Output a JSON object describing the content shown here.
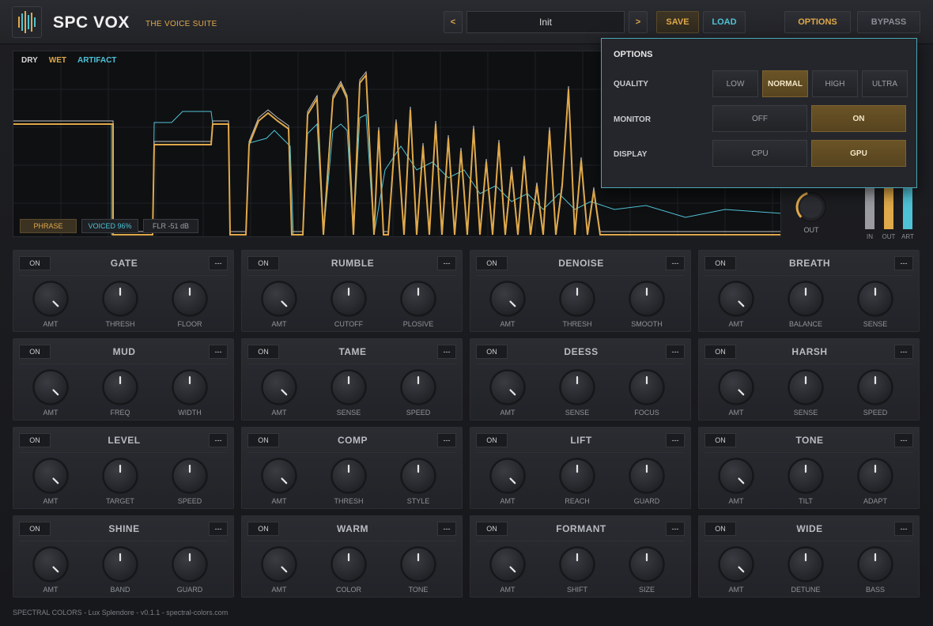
{
  "header": {
    "brand": "SPC VOX",
    "tagline": "THE VOICE SUITE",
    "prev_label": "<",
    "next_label": ">",
    "preset": "Init",
    "save_label": "SAVE",
    "load_label": "LOAD",
    "options_label": "OPTIONS",
    "bypass_label": "BYPASS"
  },
  "scope": {
    "legend": {
      "dry": "DRY",
      "wet": "WET",
      "artifact": "ARTIFACT"
    },
    "chips": {
      "phrase": "PHRASE",
      "voiced": "VOICED 96%",
      "floor": "FLR -51 dB"
    },
    "out_label": "OUT",
    "meters": {
      "in": "IN",
      "out": "OUT",
      "art": "ART"
    }
  },
  "options": {
    "title": "OPTIONS",
    "quality_label": "QUALITY",
    "quality": [
      "LOW",
      "NORMAL",
      "HIGH",
      "ULTRA"
    ],
    "quality_selected": "NORMAL",
    "monitor_label": "MONITOR",
    "monitor": [
      "OFF",
      "ON"
    ],
    "monitor_selected": "ON",
    "display_label": "DISPLAY",
    "display": [
      "CPU",
      "GPU"
    ],
    "display_selected": "GPU"
  },
  "colors": {
    "accent": "#e0a94a",
    "cyan": "#4fc3d6",
    "dry": "#d8d8d8"
  },
  "modules": [
    {
      "name": "GATE",
      "on": "ON",
      "menu": "---",
      "knobs": [
        "AMT",
        "THRESH",
        "FLOOR"
      ]
    },
    {
      "name": "RUMBLE",
      "on": "ON",
      "menu": "---",
      "knobs": [
        "AMT",
        "CUTOFF",
        "PLOSIVE"
      ]
    },
    {
      "name": "DENOISE",
      "on": "ON",
      "menu": "---",
      "knobs": [
        "AMT",
        "THRESH",
        "SMOOTH"
      ]
    },
    {
      "name": "BREATH",
      "on": "ON",
      "menu": "---",
      "knobs": [
        "AMT",
        "BALANCE",
        "SENSE"
      ]
    },
    {
      "name": "MUD",
      "on": "ON",
      "menu": "---",
      "knobs": [
        "AMT",
        "FREQ",
        "WIDTH"
      ]
    },
    {
      "name": "TAME",
      "on": "ON",
      "menu": "---",
      "knobs": [
        "AMT",
        "SENSE",
        "SPEED"
      ]
    },
    {
      "name": "DEESS",
      "on": "ON",
      "menu": "---",
      "knobs": [
        "AMT",
        "SENSE",
        "FOCUS"
      ]
    },
    {
      "name": "HARSH",
      "on": "ON",
      "menu": "---",
      "knobs": [
        "AMT",
        "SENSE",
        "SPEED"
      ]
    },
    {
      "name": "LEVEL",
      "on": "ON",
      "menu": "---",
      "knobs": [
        "AMT",
        "TARGET",
        "SPEED"
      ]
    },
    {
      "name": "COMP",
      "on": "ON",
      "menu": "---",
      "knobs": [
        "AMT",
        "THRESH",
        "STYLE"
      ]
    },
    {
      "name": "LIFT",
      "on": "ON",
      "menu": "---",
      "knobs": [
        "AMT",
        "REACH",
        "GUARD"
      ]
    },
    {
      "name": "TONE",
      "on": "ON",
      "menu": "---",
      "knobs": [
        "AMT",
        "TILT",
        "ADAPT"
      ]
    },
    {
      "name": "SHINE",
      "on": "ON",
      "menu": "---",
      "knobs": [
        "AMT",
        "BAND",
        "GUARD"
      ]
    },
    {
      "name": "WARM",
      "on": "ON",
      "menu": "---",
      "knobs": [
        "AMT",
        "COLOR",
        "TONE"
      ]
    },
    {
      "name": "FORMANT",
      "on": "ON",
      "menu": "---",
      "knobs": [
        "AMT",
        "SHIFT",
        "SIZE"
      ]
    },
    {
      "name": "WIDE",
      "on": "ON",
      "menu": "---",
      "knobs": [
        "AMT",
        "DETUNE",
        "BASS"
      ]
    }
  ],
  "footer": "SPECTRAL COLORS - Lux Splendore - v0.1.1 - spectral-colors.com"
}
